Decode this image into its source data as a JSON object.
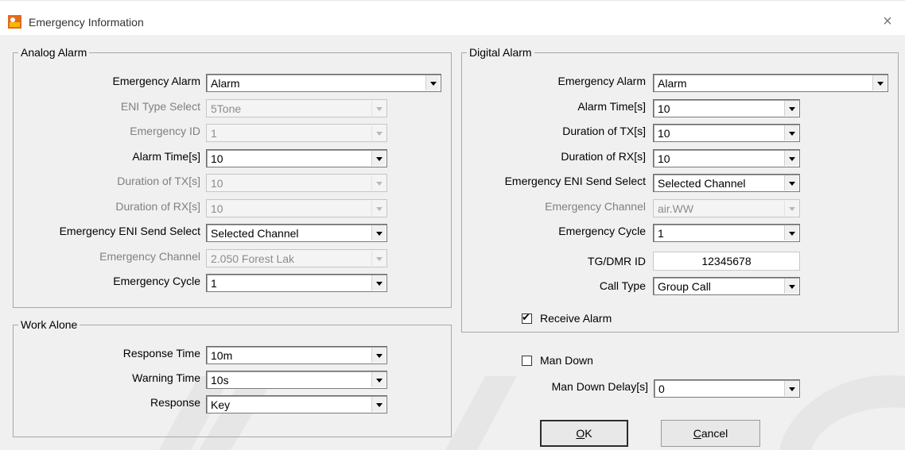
{
  "window": {
    "title": "Emergency Information",
    "close_glyph": "×"
  },
  "analog": {
    "legend": "Analog Alarm",
    "rows": [
      {
        "label": "Emergency Alarm",
        "value": "Alarm",
        "enabled": true
      },
      {
        "label": "ENI Type Select",
        "value": "5Tone",
        "enabled": false
      },
      {
        "label": "Emergency ID",
        "value": "1",
        "enabled": false
      },
      {
        "label": "Alarm Time[s]",
        "value": "10",
        "enabled": true
      },
      {
        "label": "Duration of TX[s]",
        "value": "10",
        "enabled": false
      },
      {
        "label": "Duration of RX[s]",
        "value": "10",
        "enabled": false
      },
      {
        "label": "Emergency ENI Send Select",
        "value": "Selected Channel",
        "enabled": true
      },
      {
        "label": "Emergency Channel",
        "value": "2.050 Forest Lak",
        "enabled": false
      },
      {
        "label": "Emergency Cycle",
        "value": "1",
        "enabled": true
      }
    ]
  },
  "work_alone": {
    "legend": "Work Alone",
    "rows": [
      {
        "label": "Response Time",
        "value": "10m",
        "enabled": true
      },
      {
        "label": "Warning Time",
        "value": "10s",
        "enabled": true
      },
      {
        "label": "Response",
        "value": "Key",
        "enabled": true
      }
    ]
  },
  "digital": {
    "legend": "Digital Alarm",
    "rows": [
      {
        "label": "Emergency Alarm",
        "value": "Alarm",
        "enabled": true
      },
      {
        "label": "Alarm Time[s]",
        "value": "10",
        "enabled": true
      },
      {
        "label": "Duration of TX[s]",
        "value": "10",
        "enabled": true
      },
      {
        "label": "Duration of RX[s]",
        "value": "10",
        "enabled": true
      },
      {
        "label": "Emergency ENI Send Select",
        "value": "Selected Channel",
        "enabled": true
      },
      {
        "label": "Emergency Channel",
        "value": "air.WW",
        "enabled": false
      },
      {
        "label": "Emergency Cycle",
        "value": "1",
        "enabled": true
      }
    ],
    "tg_dmr_id": {
      "label": "TG/DMR ID",
      "value": "12345678"
    },
    "call_type": {
      "label": "Call Type",
      "value": "Group Call"
    },
    "receive_alarm": {
      "label": "Receive Alarm",
      "checked": true,
      "check_glyph": "✔"
    }
  },
  "man_down": {
    "label": "Man Down",
    "checked": false,
    "delay_label": "Man Down Delay[s]",
    "delay_value": "0"
  },
  "buttons": {
    "ok": {
      "mnemonic": "O",
      "rest": "K"
    },
    "cancel": {
      "mnemonic": "C",
      "rest": "ancel"
    }
  },
  "colors": {
    "accent_icon": "#e46a1c",
    "background": "#f0f0f0"
  }
}
